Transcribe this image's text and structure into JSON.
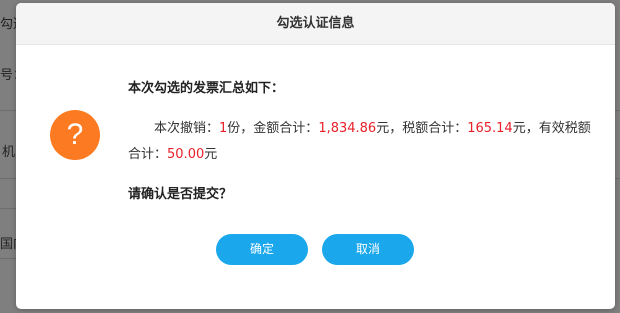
{
  "background": {
    "fragments": [
      "勾选",
      "号：",
      "机",
      "国内"
    ],
    "right_fragment": "："
  },
  "dialog": {
    "title": "勾选认证信息",
    "icon": "question-icon",
    "icon_glyph": "?",
    "icon_color": "#fb7a22",
    "heading": "本次勾选的发票汇总如下：",
    "summary": {
      "prefix_revoke": "本次撤销：",
      "revoke_count": "1",
      "unit_copies": "份，金额合计：",
      "amount_total": "1,834.86",
      "unit_yuan_tax": "元，税额合计：",
      "tax_total": "165.14",
      "unit_yuan_valid": "元，有效税额合计：",
      "valid_tax_total": "50.00",
      "unit_yuan_end": "元"
    },
    "question": "请确认是否提交？",
    "buttons": {
      "confirm": "确定",
      "cancel": "取消"
    },
    "accent_color": "#1aa7ec",
    "value_color": "#e8202a"
  }
}
